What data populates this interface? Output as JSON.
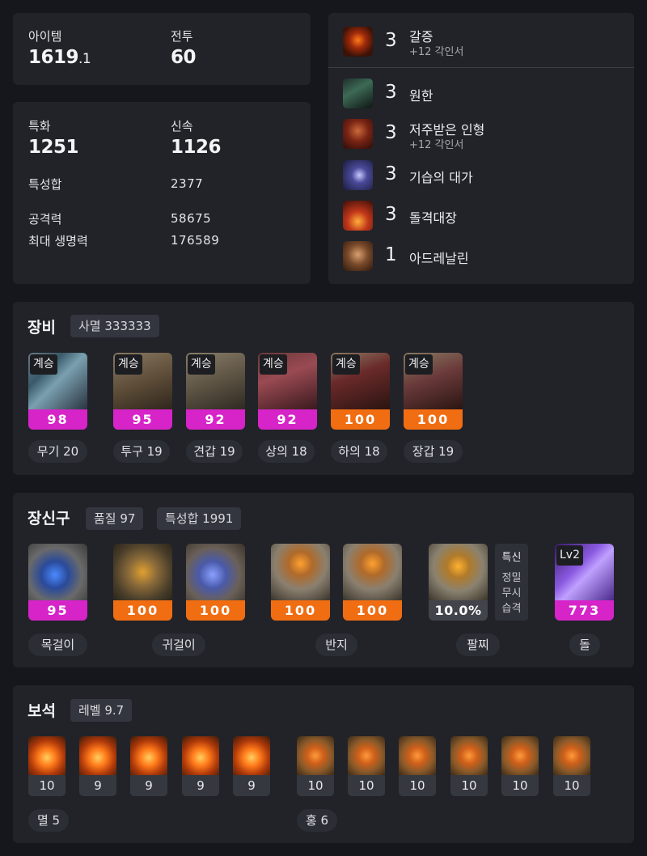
{
  "top_left": {
    "item_label": "아이템",
    "item_value_int": "1619",
    "item_value_dec": ".1",
    "combat_label": "전투",
    "combat_value": "60"
  },
  "stats": {
    "crit_label": "특화",
    "crit_value": "1251",
    "swift_label": "신속",
    "swift_value": "1126",
    "sum_label": "특성합",
    "sum_value": "2377",
    "atk_label": "공격력",
    "atk_value": "58675",
    "hp_label": "최대 생명력",
    "hp_value": "176589"
  },
  "engravings": [
    {
      "level": "3",
      "name": "갈증",
      "sub": "+12 각인서",
      "icon": "thirst-engraving-icon"
    },
    {
      "level": "3",
      "name": "원한",
      "sub": "",
      "icon": "grudge-engraving-icon"
    },
    {
      "level": "3",
      "name": "저주받은 인형",
      "sub": "+12 각인서",
      "icon": "cursed-doll-engraving-icon"
    },
    {
      "level": "3",
      "name": "기습의 대가",
      "sub": "",
      "icon": "master-ambush-engraving-icon"
    },
    {
      "level": "3",
      "name": "돌격대장",
      "sub": "",
      "icon": "raid-captain-engraving-icon"
    },
    {
      "level": "1",
      "name": "아드레날린",
      "sub": "",
      "icon": "adrenaline-engraving-icon"
    }
  ],
  "equipment": {
    "title": "장비",
    "set_chip": "사멸 333333",
    "items": [
      {
        "tag": "계승",
        "quality": "98",
        "label": "무기 20",
        "color": "#d624c8",
        "icon": "weapon-icon"
      },
      {
        "tag": "계승",
        "quality": "95",
        "label": "투구 19",
        "color": "#d624c8",
        "icon": "helmet-icon"
      },
      {
        "tag": "계승",
        "quality": "92",
        "label": "견갑 19",
        "color": "#d624c8",
        "icon": "shoulder-icon"
      },
      {
        "tag": "계승",
        "quality": "92",
        "label": "상의 18",
        "color": "#d624c8",
        "icon": "chest-icon"
      },
      {
        "tag": "계승",
        "quality": "100",
        "label": "하의 18",
        "color": "#f06d12",
        "icon": "pants-icon"
      },
      {
        "tag": "계승",
        "quality": "100",
        "label": "장갑 19",
        "color": "#f06d12",
        "icon": "gloves-icon"
      }
    ]
  },
  "accessories": {
    "title": "장신구",
    "quality_chip": "품질 97",
    "sum_chip": "특성합 1991",
    "items": [
      {
        "quality": "95",
        "color": "#d624c8",
        "icon": "necklace-icon"
      },
      {
        "quality": "100",
        "color": "#f06d12",
        "icon": "earring-icon"
      },
      {
        "quality": "100",
        "color": "#f06d12",
        "icon": "earring-icon"
      },
      {
        "quality": "100",
        "color": "#f06d12",
        "icon": "ring-icon"
      },
      {
        "quality": "100",
        "color": "#f06d12",
        "icon": "ring-icon"
      }
    ],
    "bracelet": {
      "value": "10.0%",
      "stats": [
        "특신",
        "정밀",
        "무시",
        "습격"
      ],
      "icon": "bracelet-icon"
    },
    "stone": {
      "tag": "Lv2",
      "value": "773",
      "icon": "ability-stone-icon"
    },
    "labels": {
      "necklace": "목걸이",
      "earring": "귀걸이",
      "ring": "반지",
      "bracelet": "팔찌",
      "stone": "돌"
    }
  },
  "gems": {
    "title": "보석",
    "level_chip": "레벨 9.7",
    "annihilation": [
      "10",
      "9",
      "9",
      "9",
      "9"
    ],
    "crimson": [
      "10",
      "10",
      "10",
      "10",
      "10",
      "10"
    ],
    "annihilation_label": "멸 5",
    "crimson_label": "홍 6"
  }
}
